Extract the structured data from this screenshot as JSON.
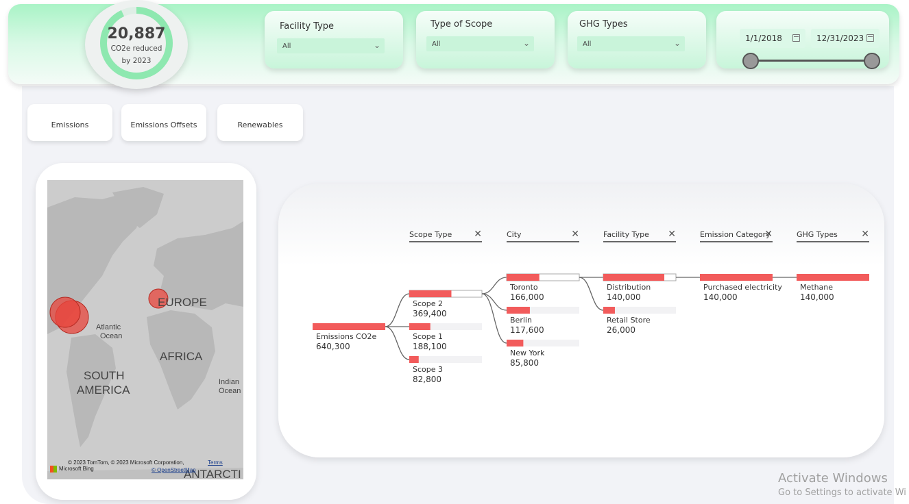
{
  "kpi": {
    "value": "20,887",
    "label_line1": "CO2e reduced",
    "label_line2": "by 2023",
    "progress": 0.93
  },
  "slicers": [
    {
      "title": "Facility Type",
      "value": "All"
    },
    {
      "title": "Type of Scope",
      "value": "All"
    },
    {
      "title": "GHG Types",
      "value": "All"
    }
  ],
  "date_range": {
    "start": "1/1/2018",
    "end": "12/31/2023"
  },
  "nav": {
    "emissions": "Emissions",
    "offsets": "Emissions Offsets",
    "renewables": "Renewables"
  },
  "map": {
    "labels": {
      "europe": "EUROPE",
      "atlantic1": "Atlantic",
      "atlantic2": "Ocean",
      "africa": "AFRICA",
      "south1": "SOUTH",
      "south2": "AMERICA",
      "indian1": "Indian",
      "indian2": "Ocean",
      "antarctica": "ANTARCTI"
    },
    "copyright": "© 2023 TomTom, © 2023 Microsoft Corporation,",
    "terms": "Terms",
    "osm": "© OpenStreetMap",
    "bing": "Microsoft Bing"
  },
  "decomp": {
    "levels": [
      "Scope Type",
      "City",
      "Facility Type",
      "Emission Category",
      "GHG Types"
    ],
    "root": {
      "name": "Emissions CO2e",
      "value": "640,300"
    },
    "scope": [
      {
        "name": "Scope 2",
        "value": "369,400",
        "fraction": 0.58
      },
      {
        "name": "Scope 1",
        "value": "188,100",
        "fraction": 0.29
      },
      {
        "name": "Scope 3",
        "value": "82,800",
        "fraction": 0.13
      }
    ],
    "city": [
      {
        "name": "Toronto",
        "value": "166,000",
        "fraction": 0.45
      },
      {
        "name": "Berlin",
        "value": "117,600",
        "fraction": 0.32
      },
      {
        "name": "New York",
        "value": "85,800",
        "fraction": 0.23
      }
    ],
    "facility": [
      {
        "name": "Distribution",
        "value": "140,000",
        "fraction": 0.84
      },
      {
        "name": "Retail Store",
        "value": "26,000",
        "fraction": 0.16
      }
    ],
    "category": [
      {
        "name": "Purchased electricity",
        "value": "140,000",
        "fraction": 1.0
      }
    ],
    "ghg": [
      {
        "name": "Methane",
        "value": "140,000",
        "fraction": 1.0
      }
    ]
  },
  "watermark": {
    "line1": "Activate Windows",
    "line2": "Go to Settings to activate Wi"
  },
  "colors": {
    "accent": "#f25b5b",
    "ring": "#8ee8b0",
    "header": "#a9f3c6"
  }
}
